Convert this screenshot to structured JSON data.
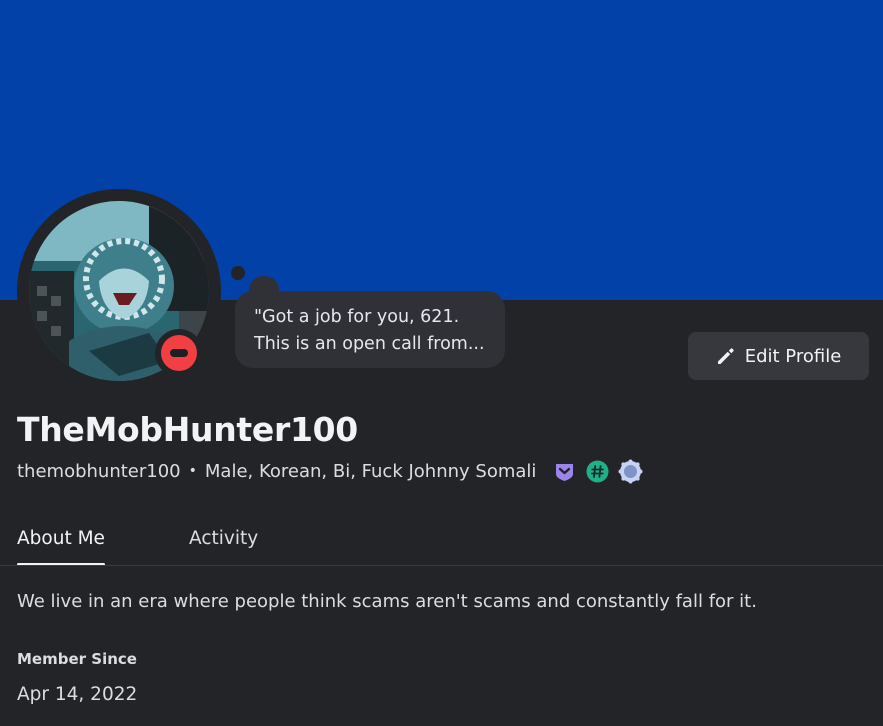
{
  "profile": {
    "banner_color": "#0141a8",
    "display_name": "TheMobHunter100",
    "username": "themobhunter100",
    "separator": "•",
    "pronouns": "Male, Korean, Bi, Fuck Johnny Somali",
    "status": "do-not-disturb",
    "status_color": "#f23f43",
    "custom_status": {
      "line1": "\"Got a job for you, 621.",
      "line2": "This is an open call from..."
    },
    "badges": [
      {
        "icon": "nitro-badge-icon",
        "color": "#9b84ec"
      },
      {
        "icon": "hashtag-badge-icon",
        "color": "#1fb08a"
      },
      {
        "icon": "quest-badge-icon",
        "color": "#a7b8e8"
      }
    ]
  },
  "actions": {
    "edit_profile": "Edit Profile",
    "edit_icon": "pencil-icon"
  },
  "tabs": [
    {
      "label": "About Me",
      "active": true
    },
    {
      "label": "Activity",
      "active": false
    }
  ],
  "about": {
    "bio": "We live in an era where people think scams aren't scams and constantly fall for it.",
    "member_since_heading": "Member Since",
    "member_since_date": "Apr 14, 2022"
  }
}
